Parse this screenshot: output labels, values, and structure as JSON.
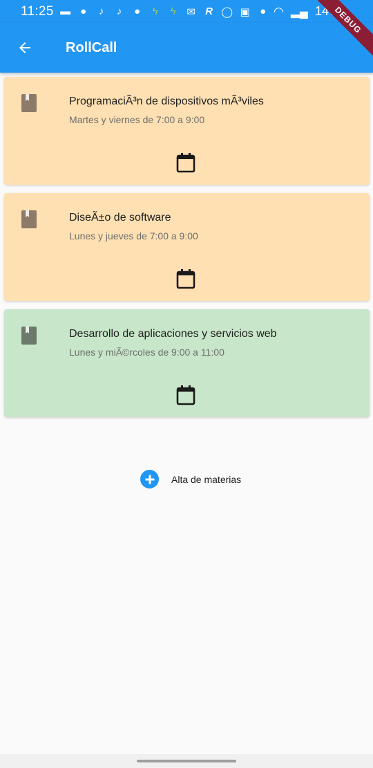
{
  "status_bar": {
    "time": "11:25",
    "battery": "14%",
    "notification_icons": [
      "message-icon",
      "facebook-icon",
      "tiktok-icon",
      "tiktok-icon",
      "reddit-icon",
      "bolt-icon",
      "bolt-icon",
      "gmail-icon",
      "r-app-icon",
      "whatsapp-icon",
      "gallery-icon",
      "app-icon"
    ]
  },
  "debug_banner": "DEBUG",
  "app_bar": {
    "title": "RollCall",
    "color": "#2196f3"
  },
  "courses": [
    {
      "title": "ProgramaciÃ³n de dispositivos mÃ³viles",
      "schedule": "Martes y viernes de 7:00 a 9:00",
      "color": "#ffe0b2",
      "icon_color": "#8d7b68"
    },
    {
      "title": "DiseÃ±o de software",
      "schedule": "Lunes y jueves de 7:00 a 9:00",
      "color": "#ffe0b2",
      "icon_color": "#8d7b68"
    },
    {
      "title": "Desarrollo de aplicaciones y servicios web",
      "schedule": "Lunes y miÃ©rcoles de 9:00 a 11:00",
      "color": "#c8e6c9",
      "icon_color": "#6b7a6b"
    }
  ],
  "add_button": {
    "label": "Alta de materias"
  }
}
